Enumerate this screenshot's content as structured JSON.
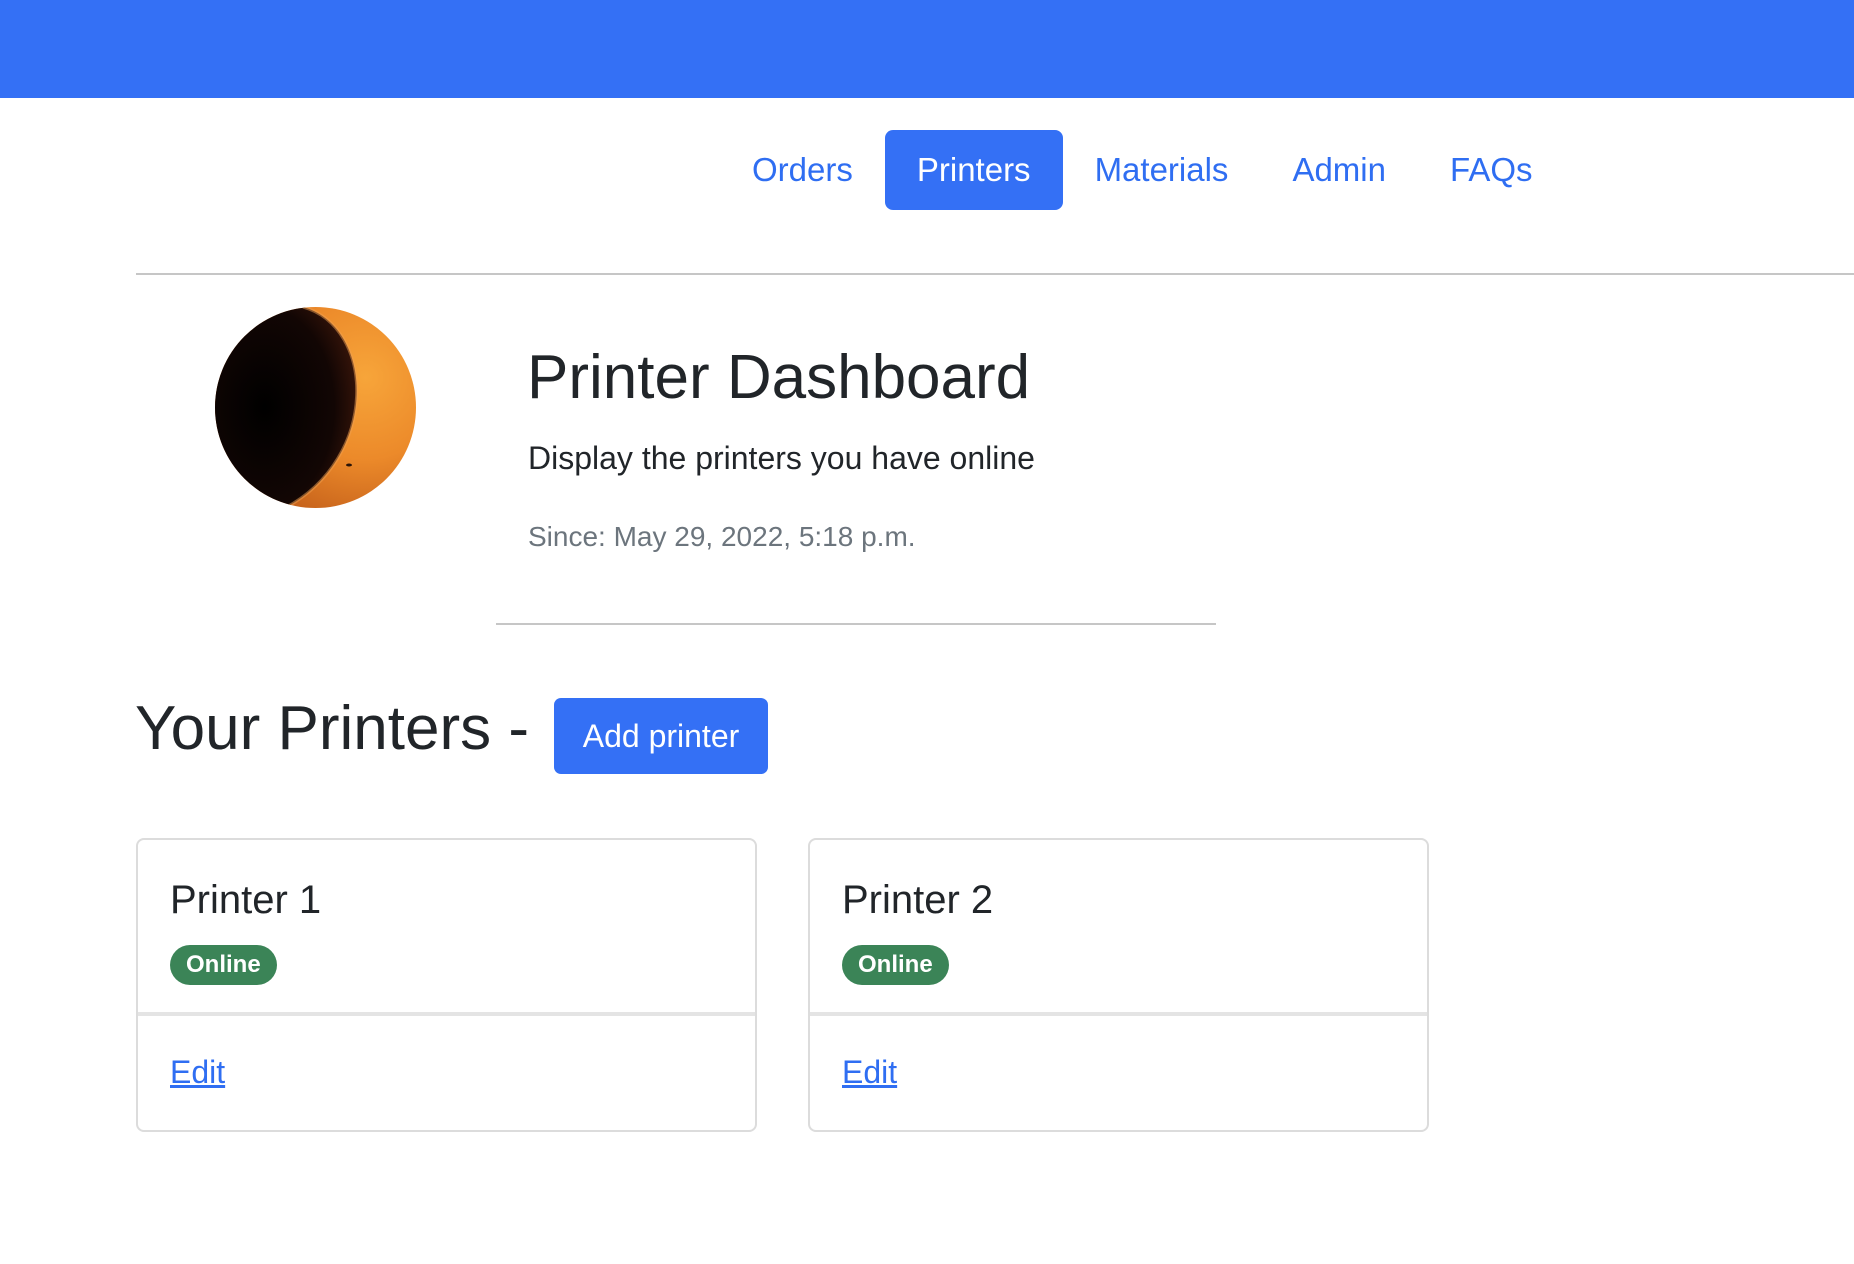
{
  "header": {
    "bar_color": "#3470f5"
  },
  "nav": {
    "items": [
      {
        "label": "Orders",
        "active": false
      },
      {
        "label": "Printers",
        "active": true
      },
      {
        "label": "Materials",
        "active": false
      },
      {
        "label": "Admin",
        "active": false
      },
      {
        "label": "FAQs",
        "active": false
      }
    ]
  },
  "profile": {
    "avatar": "profile-image",
    "title": "Printer Dashboard",
    "subtitle": "Display the printers you have online",
    "since": "Since: May 29, 2022, 5:18 p.m."
  },
  "printers_section": {
    "heading": "Your Printers -",
    "add_button_label": "Add printer",
    "cards": [
      {
        "name": "Printer 1",
        "status": "Online",
        "edit_label": "Edit"
      },
      {
        "name": "Printer 2",
        "status": "Online",
        "edit_label": "Edit"
      }
    ]
  },
  "colors": {
    "primary": "#3470f5",
    "link": "#2f6ef2",
    "success_badge": "#3b8457",
    "muted_text": "#6c757d"
  }
}
